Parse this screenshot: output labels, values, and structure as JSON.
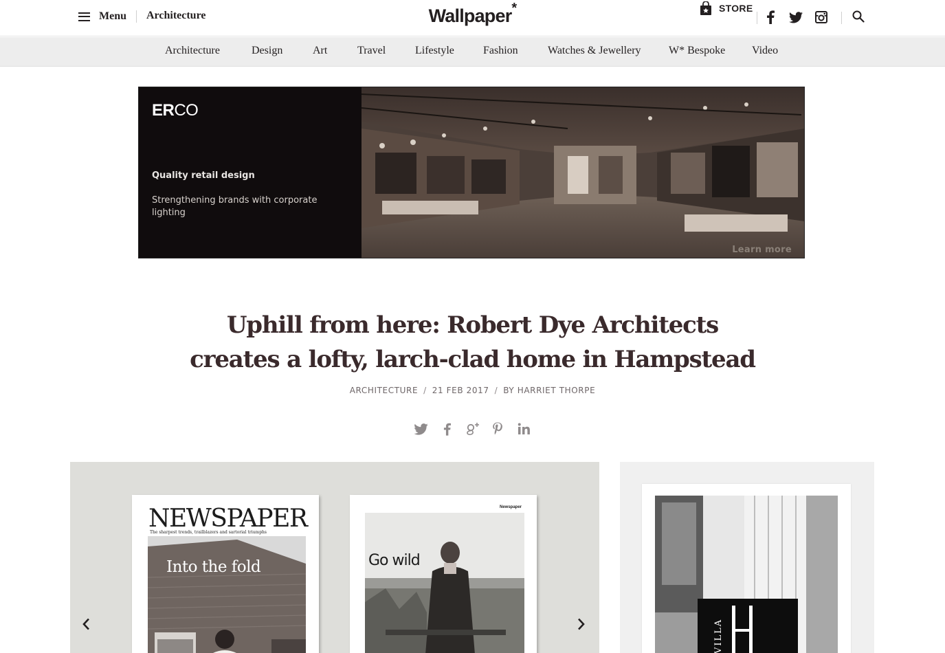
{
  "header": {
    "menu_label": "Menu",
    "section_label": "Architecture",
    "logo": "Wallpaper",
    "logo_mark": "*",
    "store_label": "STORE"
  },
  "icons": {
    "menu": "hamburger-icon",
    "store": "shopping-bag-icon",
    "facebook": "facebook-icon",
    "twitter": "twitter-icon",
    "instagram": "instagram-icon",
    "search": "search-icon"
  },
  "nav": {
    "items": [
      {
        "label": "Architecture"
      },
      {
        "label": "Design"
      },
      {
        "label": "Art"
      },
      {
        "label": "Travel"
      },
      {
        "label": "Lifestyle"
      },
      {
        "label": "Fashion"
      },
      {
        "label": "Watches & Jewellery"
      },
      {
        "label": "W* Bespoke"
      },
      {
        "label": "Video"
      }
    ]
  },
  "ad": {
    "brand_bold": "ER",
    "brand_rest": "CO",
    "headline": "Quality retail design",
    "copy": "Strengthening brands with corporate lighting",
    "cta": "Learn more"
  },
  "article": {
    "title": "Uphill from here: Robert Dye Architects creates a lofty, larch-clad home in Hampstead",
    "category": "ARCHITECTURE",
    "date": "21 FEB 2017",
    "author": "BY HARRIET THORPE",
    "share_icons": [
      "twitter-icon",
      "facebook-icon",
      "google-plus-icon",
      "pinterest-icon",
      "linkedin-icon"
    ]
  },
  "gallery": {
    "cover1": {
      "masthead": "NEWSPAPER",
      "tagline": "The sharpest trends, trailblazers and sartorial triumphs",
      "headline": "Into the fold"
    },
    "cover2": {
      "corner": "Newspaper",
      "headline": "Go wild"
    },
    "prev_icon": "chevron-left-icon",
    "next_icon": "chevron-right-icon"
  },
  "side_ad": {
    "brand": "VILLA"
  },
  "colors": {
    "text": "#231f20",
    "headline": "#3a2a2c",
    "nav_bg": "#ededed",
    "gallery_bg": "#dededa",
    "meta": "#6e6668"
  }
}
